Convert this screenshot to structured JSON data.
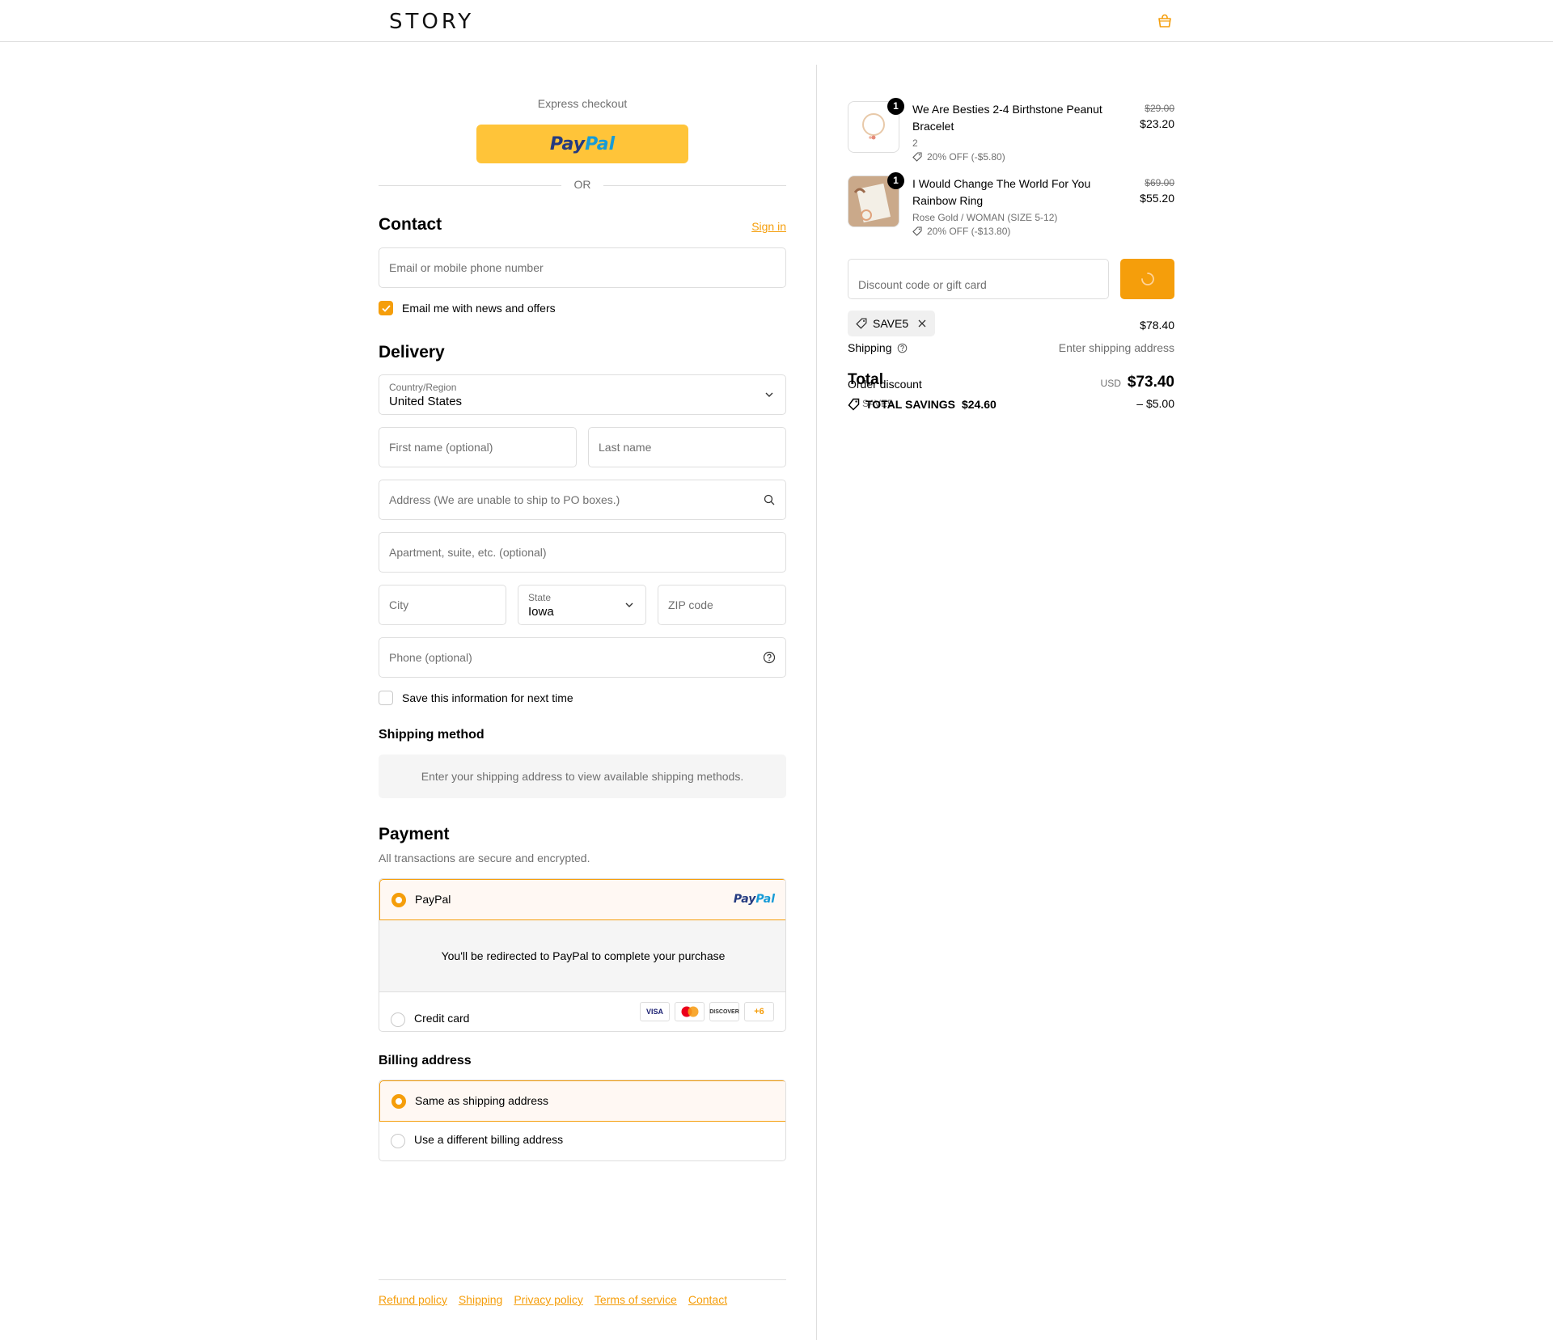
{
  "header": {
    "logo": "STORY",
    "cart_icon": "shopping-bag-icon"
  },
  "express": {
    "title": "Express checkout",
    "paypal_a": "Pay",
    "paypal_b": "Pal",
    "or": "OR"
  },
  "contact": {
    "heading": "Contact",
    "sign_in": "Sign in",
    "email_placeholder": "Email or mobile phone number",
    "news_label": "Email me with news and offers",
    "news_checked": true
  },
  "delivery": {
    "heading": "Delivery",
    "country_label": "Country/Region",
    "country_value": "United States",
    "first_name": "First name (optional)",
    "last_name": "Last name",
    "address": "Address (We are unable to ship to PO boxes.)",
    "apartment": "Apartment, suite, etc. (optional)",
    "city": "City",
    "state_label": "State",
    "state_value": "Iowa",
    "zip": "ZIP code",
    "phone": "Phone (optional)",
    "save_info": "Save this information for next time"
  },
  "shipping_method": {
    "heading": "Shipping method",
    "note": "Enter your shipping address to view available shipping methods."
  },
  "payment": {
    "heading": "Payment",
    "subtitle": "All transactions are secure and encrypted.",
    "paypal_label": "PayPal",
    "redirect_note": "You'll be redirected to PayPal to complete your purchase",
    "credit_label": "Credit card",
    "cards": [
      "VISA",
      "MC",
      "DISCOVER",
      "+6"
    ]
  },
  "billing": {
    "heading": "Billing address",
    "same": "Same as shipping address",
    "different": "Use a different billing address"
  },
  "footer": {
    "links": [
      "Refund policy",
      "Shipping",
      "Privacy policy",
      "Terms of service",
      "Contact"
    ]
  },
  "summary": {
    "items": [
      {
        "qty": "1",
        "name": "We Are Besties 2-4 Birthstone Peanut Bracelet",
        "meta": "2",
        "discount": "20% OFF (-$5.80)",
        "original_price": "$29.00",
        "price": "$23.20"
      },
      {
        "qty": "1",
        "name": "I Would Change The World For You Rainbow Ring",
        "meta": "Rose Gold / WOMAN (SIZE 5-12)",
        "discount": "20% OFF (-$13.80)",
        "original_price": "$69.00",
        "price": "$55.20"
      }
    ],
    "discount_placeholder": "Discount code or gift card",
    "applied_code": "SAVE5",
    "subtotal_value": "$78.40",
    "shipping_label": "Shipping",
    "shipping_value": "Enter shipping address",
    "total_label": "Total",
    "order_discount_label": "Order discount",
    "order_discount_value": "– $5.00",
    "save5_tag": "SAVE5",
    "currency": "USD",
    "total_value": "$73.40",
    "savings_label": "TOTAL SAVINGS",
    "savings_value": "$24.60"
  },
  "colors": {
    "accent": "#f59e0b",
    "paypal_yellow": "#ffc439",
    "paypal_dark": "#253b80",
    "paypal_light": "#179bd7"
  }
}
